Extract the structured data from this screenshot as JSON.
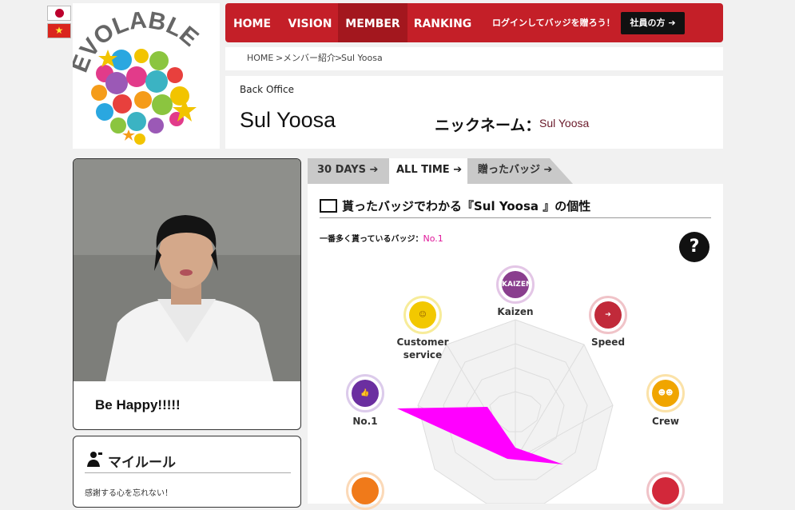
{
  "languages": [
    {
      "name": "japanese-flag"
    },
    {
      "name": "vietnam-flag"
    }
  ],
  "logo": {
    "text": "EVOLABLE ASIA"
  },
  "nav": {
    "items": [
      {
        "label": "HOME"
      },
      {
        "label": "VISION"
      },
      {
        "label": "MEMBER"
      },
      {
        "label": "RANKING"
      }
    ],
    "cta": "ログインしてバッジを贈ろう！",
    "staff_button": "社員の方"
  },
  "breadcrumb": {
    "home": "HOME",
    "members": "メンバー紹介",
    "current": "Sul Yoosa"
  },
  "profile": {
    "department": "Back Office",
    "name": "Sul Yoosa",
    "nickname_label": "ニックネーム：",
    "nickname": "Sul Yoosa",
    "motto": "Be Happy!!!!!"
  },
  "my_rule": {
    "title": "マイルール",
    "text": "感謝する心を忘れない！"
  },
  "tabs": [
    {
      "label": "30 DAYS"
    },
    {
      "label": "ALL TIME"
    },
    {
      "label": "贈ったバッジ"
    }
  ],
  "personality": {
    "title": "貰ったバッジでわかる『Sul Yoosa 』の個性",
    "most_label": "一番多く貰っているバッジ：",
    "most_value": "No.1",
    "help": "?"
  },
  "badges": [
    {
      "label": "Kaizen",
      "icon": "kaizen-badge",
      "color": "#8a3e8e"
    },
    {
      "label": "Speed",
      "icon": "speed-badge",
      "color": "#c12a3a"
    },
    {
      "label": "Crew",
      "icon": "crew-badge",
      "color": "#f0a500"
    },
    {
      "label": "Customer service",
      "icon": "customer-service-badge",
      "color": "#f2c800"
    },
    {
      "label": "No.1",
      "icon": "no1-badge",
      "color": "#6b2fa0"
    }
  ],
  "colors": {
    "brand": "#c41f28",
    "accent": "#ff00cc",
    "nickname": "#6a1a2a"
  }
}
